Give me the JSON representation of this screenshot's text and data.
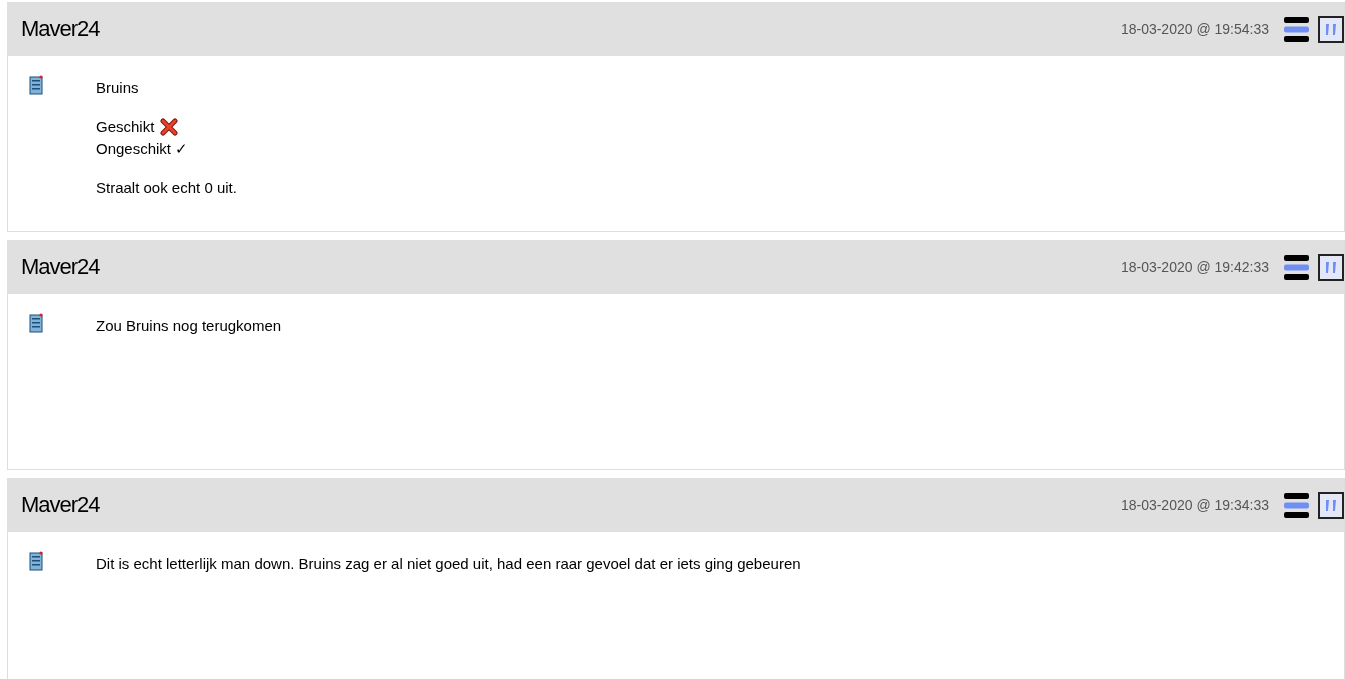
{
  "posts": [
    {
      "author": "Maver24",
      "date": "18-03-2020 @ 19:54:33",
      "paragraphs": [
        [
          {
            "text": "Bruins"
          }
        ],
        [
          {
            "text": "Geschikt",
            "crossed": true
          },
          {
            "text": "Ongeschikt ✓"
          }
        ],
        [
          {
            "text": "Straalt ook echt 0 uit."
          }
        ]
      ]
    },
    {
      "author": "Maver24",
      "date": "18-03-2020 @ 19:42:33",
      "paragraphs": [
        [
          {
            "text": "Zou Bruins nog terugkomen"
          }
        ]
      ]
    },
    {
      "author": "Maver24",
      "date": "18-03-2020 @ 19:34:33",
      "paragraphs": [
        [
          {
            "text": "Dit is echt letterlijk man down. Bruins zag er al niet goed uit, had een raar gevoel dat er iets ging gebeuren"
          }
        ]
      ]
    }
  ]
}
